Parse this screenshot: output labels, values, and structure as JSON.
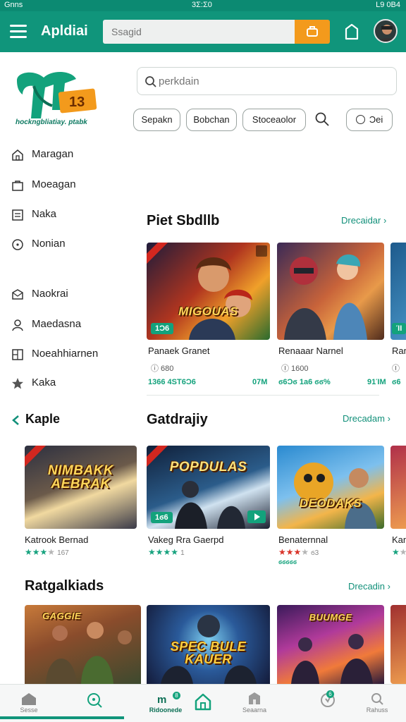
{
  "status_bar": {
    "left": "Gnns",
    "center": "3Σ:Σ0",
    "right": "L9 0Β4"
  },
  "header": {
    "title": "Apldiai",
    "search_placeholder": "Ssagid",
    "search_button_text": "Ⓗ"
  },
  "brand": {
    "logo_letters": "TTV",
    "logo_badge": "13",
    "tagline": "hockngbliatiay. ptabk"
  },
  "search": {
    "placeholder": "perkdain",
    "chips": [
      "Sepakn",
      "Bobchan",
      "Stoceaolor"
    ],
    "last_chip": "Ͻei"
  },
  "sidebar": {
    "items": [
      {
        "label": "Maragan",
        "icon": "house-icon"
      },
      {
        "label": "Moeagan",
        "icon": "bag-icon"
      },
      {
        "label": "Naka",
        "icon": "document-icon"
      },
      {
        "label": "Nonian",
        "icon": "info-icon"
      },
      {
        "label": "Naokrai",
        "icon": "mail-icon"
      },
      {
        "label": "Maedasna",
        "icon": "person-icon"
      },
      {
        "label": "Noeahhiarnen",
        "icon": "grid-icon"
      },
      {
        "label": "Kaka",
        "icon": "star-icon"
      }
    ],
    "back_label": "Kaple"
  },
  "sections": [
    {
      "title": "Piet Sbdllb",
      "link": "Drecaidar",
      "cards": [
        {
          "art_text": "MIGOUAS",
          "badge": "1Ɔ6",
          "name": "Panaek Granet",
          "meta": "ⓘ 680",
          "stats_left": "1366  4ST6Ɔ6",
          "stats_right": "07M"
        },
        {
          "art_text": "",
          "badge": "",
          "name": "Renaaar Narnel",
          "meta": "Ⓘ 1600",
          "stats_left": "ϭ6Ɔϭ  1a6 ϭϭ%",
          "stats_right": "91ΊΜ"
        },
        {
          "art_text": "",
          "badge": "ΊΙ",
          "name": "Ran",
          "meta": "Ⓘ",
          "stats_left": "ϭ6",
          "stats_right": ""
        }
      ]
    },
    {
      "title": "Gatdrajiy",
      "link": "Drecadam",
      "cards": [
        {
          "art_text": "NIMBAKK AEBRAK",
          "name": "Katrook Bernad",
          "rating": 3,
          "rating_color": "green",
          "count": "167"
        },
        {
          "art_text": "POPDULAS",
          "badge": "1ϭ6",
          "name": "Vakeg Rra Gaerpd",
          "rating": 4,
          "rating_color": "green",
          "count": "1"
        },
        {
          "art_text": "DEODAKS",
          "name": "Benaternnal",
          "rating": 3,
          "rating_color": "red",
          "count": "ϭ3",
          "sub": "ϭϭϭϭϭ"
        },
        {
          "art_text": "",
          "name": "Kan",
          "rating": 1,
          "rating_color": "green",
          "count": ""
        }
      ]
    },
    {
      "title": "Ratgalkiads",
      "link": "Drecadin",
      "cards": [
        {
          "art_text": "GAGGIE"
        },
        {
          "art_text": "SPEC BULE KAUER"
        },
        {
          "art_text": "BUUMGE"
        }
      ]
    }
  ],
  "bottom_nav": [
    {
      "label": "Sesse",
      "icon": "home-icon",
      "badge": ""
    },
    {
      "label": "",
      "icon": "search-icon",
      "badge": ""
    },
    {
      "label": "Ridoonede",
      "icon": "games-icon",
      "badge": "8"
    },
    {
      "label": "",
      "icon": "home-outline-icon",
      "badge": ""
    },
    {
      "label": "Seaarna",
      "icon": "store-icon",
      "badge": ""
    },
    {
      "label": "",
      "icon": "rewards-icon",
      "badge": "6"
    },
    {
      "label": "Rahuss",
      "icon": "profile-icon",
      "badge": ""
    }
  ],
  "colors": {
    "primary": "#10957b",
    "accent": "#f39a1c",
    "rating_green": "#18a37f",
    "rating_red": "#d9342a"
  }
}
